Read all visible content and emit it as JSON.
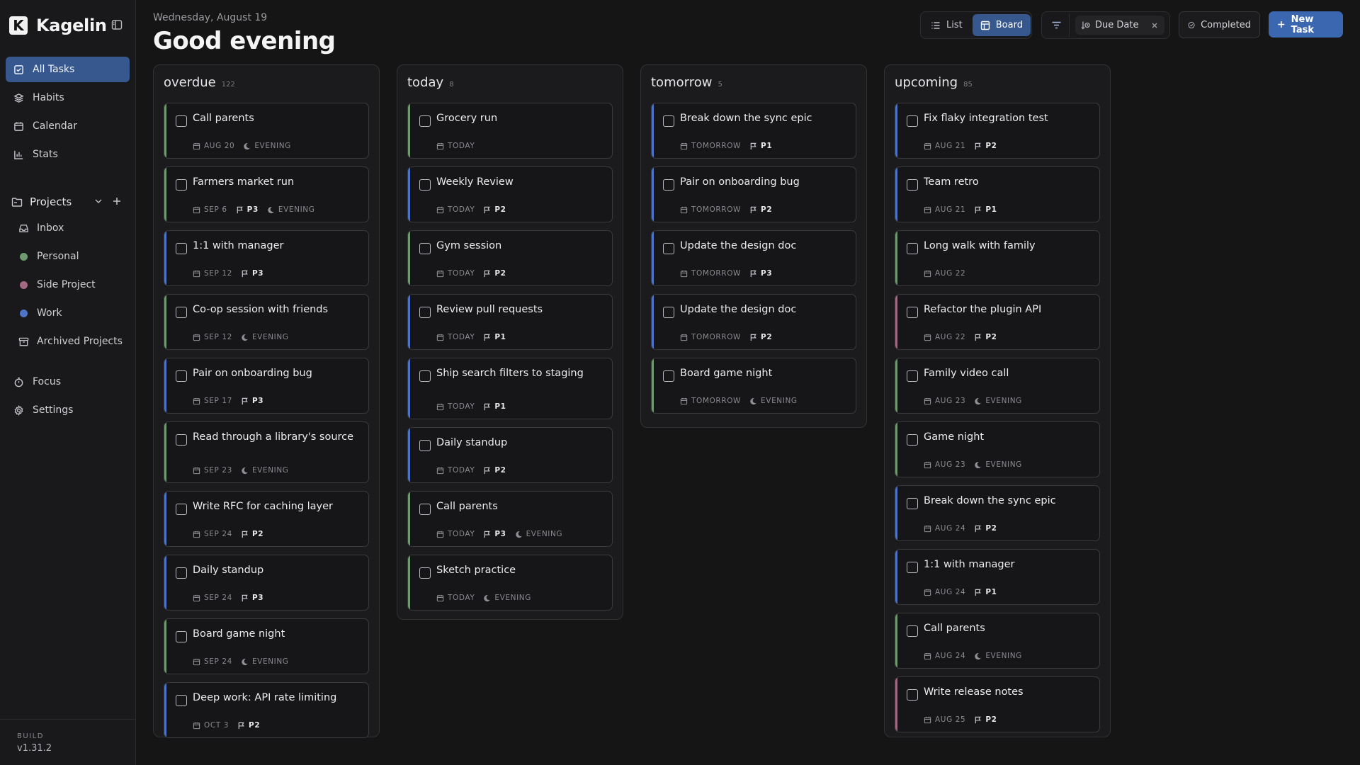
{
  "app": {
    "name": "Kagelin",
    "logo_letter": "K",
    "build_label": "BUILD",
    "build_version": "v1.31.2"
  },
  "colors": {
    "accent": "#36588e",
    "primary_button": "#3b66b0",
    "project_personal": "#6f9a6f",
    "project_side": "#a26a82",
    "project_work": "#4d74c6"
  },
  "nav": {
    "all_tasks": "All Tasks",
    "habits": "Habits",
    "calendar": "Calendar",
    "stats": "Stats",
    "projects": "Projects",
    "inbox": "Inbox",
    "personal": "Personal",
    "side_project": "Side Project",
    "work": "Work",
    "archived": "Archived Projects",
    "focus": "Focus",
    "settings": "Settings"
  },
  "header": {
    "date": "Wednesday, August 19",
    "greeting": "Good evening"
  },
  "toolbar": {
    "list": "List",
    "board": "Board",
    "sort_chip": "Due Date",
    "completed": "Completed",
    "new_task": "New Task"
  },
  "columns": [
    {
      "title": "overdue",
      "count": "122",
      "cards": [
        {
          "title": "Call parents",
          "date": "AUG 20",
          "priority": "",
          "evening": "EVENING",
          "project": "personal"
        },
        {
          "title": "Farmers market run",
          "date": "SEP 6",
          "priority": "P3",
          "evening": "EVENING",
          "project": "personal"
        },
        {
          "title": "1:1 with manager",
          "date": "SEP 12",
          "priority": "P3",
          "evening": "",
          "project": "work"
        },
        {
          "title": "Co-op session with friends",
          "date": "SEP 12",
          "priority": "",
          "evening": "EVENING",
          "project": "personal"
        },
        {
          "title": "Pair on onboarding bug",
          "date": "SEP 17",
          "priority": "P3",
          "evening": "",
          "project": "work"
        },
        {
          "title": "Read through a library's source",
          "date": "SEP 23",
          "priority": "",
          "evening": "EVENING",
          "project": "personal"
        },
        {
          "title": "Write RFC for caching layer",
          "date": "SEP 24",
          "priority": "P2",
          "evening": "",
          "project": "work"
        },
        {
          "title": "Daily standup",
          "date": "SEP 24",
          "priority": "P3",
          "evening": "",
          "project": "work"
        },
        {
          "title": "Board game night",
          "date": "SEP 24",
          "priority": "",
          "evening": "EVENING",
          "project": "personal"
        },
        {
          "title": "Deep work: API rate limiting",
          "date": "OCT 3",
          "priority": "P2",
          "evening": "",
          "project": "work"
        }
      ]
    },
    {
      "title": "today",
      "count": "8",
      "cards": [
        {
          "title": "Grocery run",
          "date": "TODAY",
          "priority": "",
          "evening": "",
          "project": "personal"
        },
        {
          "title": "Weekly Review",
          "date": "TODAY",
          "priority": "P2",
          "evening": "",
          "project": "work"
        },
        {
          "title": "Gym session",
          "date": "TODAY",
          "priority": "P2",
          "evening": "",
          "project": "personal"
        },
        {
          "title": "Review pull requests",
          "date": "TODAY",
          "priority": "P1",
          "evening": "",
          "project": "work"
        },
        {
          "title": "Ship search filters to staging",
          "date": "TODAY",
          "priority": "P1",
          "evening": "",
          "project": "work"
        },
        {
          "title": "Daily standup",
          "date": "TODAY",
          "priority": "P2",
          "evening": "",
          "project": "work"
        },
        {
          "title": "Call parents",
          "date": "TODAY",
          "priority": "P3",
          "evening": "EVENING",
          "project": "personal"
        },
        {
          "title": "Sketch practice",
          "date": "TODAY",
          "priority": "",
          "evening": "EVENING",
          "project": "personal"
        }
      ]
    },
    {
      "title": "tomorrow",
      "count": "5",
      "cards": [
        {
          "title": "Break down the sync epic",
          "date": "TOMORROW",
          "priority": "P1",
          "evening": "",
          "project": "work"
        },
        {
          "title": "Pair on onboarding bug",
          "date": "TOMORROW",
          "priority": "P2",
          "evening": "",
          "project": "work"
        },
        {
          "title": "Update the design doc",
          "date": "TOMORROW",
          "priority": "P3",
          "evening": "",
          "project": "work"
        },
        {
          "title": "Update the design doc",
          "date": "TOMORROW",
          "priority": "P2",
          "evening": "",
          "project": "work"
        },
        {
          "title": "Board game night",
          "date": "TOMORROW",
          "priority": "",
          "evening": "EVENING",
          "project": "personal"
        }
      ]
    },
    {
      "title": "upcoming",
      "count": "85",
      "cards": [
        {
          "title": "Fix flaky integration test",
          "date": "AUG 21",
          "priority": "P2",
          "evening": "",
          "project": "work"
        },
        {
          "title": "Team retro",
          "date": "AUG 21",
          "priority": "P1",
          "evening": "",
          "project": "work"
        },
        {
          "title": "Long walk with family",
          "date": "AUG 22",
          "priority": "",
          "evening": "",
          "project": "personal"
        },
        {
          "title": "Refactor the plugin API",
          "date": "AUG 22",
          "priority": "P2",
          "evening": "",
          "project": "side"
        },
        {
          "title": "Family video call",
          "date": "AUG 23",
          "priority": "",
          "evening": "EVENING",
          "project": "personal"
        },
        {
          "title": "Game night",
          "date": "AUG 23",
          "priority": "",
          "evening": "EVENING",
          "project": "personal"
        },
        {
          "title": "Break down the sync epic",
          "date": "AUG 24",
          "priority": "P2",
          "evening": "",
          "project": "work"
        },
        {
          "title": "1:1 with manager",
          "date": "AUG 24",
          "priority": "P1",
          "evening": "",
          "project": "work"
        },
        {
          "title": "Call parents",
          "date": "AUG 24",
          "priority": "",
          "evening": "EVENING",
          "project": "personal"
        },
        {
          "title": "Write release notes",
          "date": "AUG 25",
          "priority": "P2",
          "evening": "",
          "project": "side"
        }
      ]
    }
  ]
}
